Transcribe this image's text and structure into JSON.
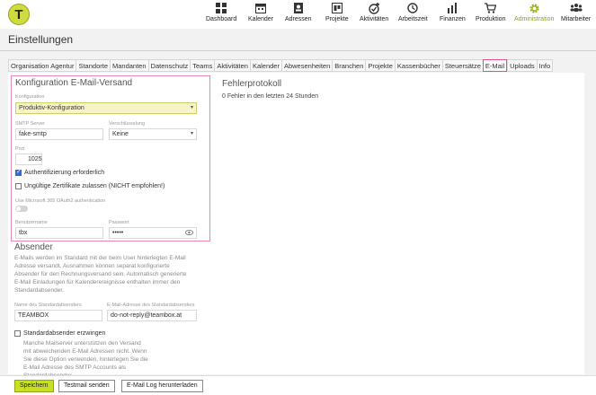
{
  "app": {
    "logo_letter": "T"
  },
  "nav": [
    {
      "label": "Dashboard",
      "icon": "grid-icon"
    },
    {
      "label": "Kalender",
      "icon": "calendar-icon"
    },
    {
      "label": "Adressen",
      "icon": "address-book-icon"
    },
    {
      "label": "Projekte",
      "icon": "folder-icon"
    },
    {
      "label": "Aktivitäten",
      "icon": "activity-icon"
    },
    {
      "label": "Arbeitszeit",
      "icon": "clock-icon"
    },
    {
      "label": "Finanzen",
      "icon": "finance-chart-icon"
    },
    {
      "label": "Produktion",
      "icon": "cart-icon"
    },
    {
      "label": "Administration",
      "icon": "gear-icon"
    },
    {
      "label": "Mitarbeiter",
      "icon": "users-icon"
    }
  ],
  "page_title": "Einstellungen",
  "tabs": [
    "Organisation Agentur",
    "Standorte",
    "Mandanten",
    "Datenschutz",
    "Teams",
    "Aktivitäten",
    "Kalender",
    "Abwesenheiten",
    "Branchen",
    "Projekte",
    "Kassenbücher",
    "Steuersätze",
    "E-Mail",
    "Uploads",
    "Info"
  ],
  "active_tab": "E-Mail",
  "config": {
    "heading": "Konfiguration E-Mail-Versand",
    "konfiguration_label": "Konfiguration",
    "konfiguration_value": "Produktiv-Konfiguration",
    "smtp_label": "SMTP Server",
    "smtp_value": "fake-smtp",
    "encryption_label": "Verschlüsselung",
    "encryption_value": "Keine",
    "port_label": "Port",
    "port_value": "1025",
    "auth_label": "Authentifizierung erforderlich",
    "auth_checked": true,
    "invalid_certs_label": "Ungültige Zertifikate zulassen (NICHT empfohlen!)",
    "invalid_certs_checked": false,
    "oauth_label": "Use Microsoft 365 OAuth2 authentication",
    "oauth_on": false,
    "username_label": "Benutzername",
    "username_value": "tbx",
    "password_label": "Passwort",
    "password_value": "•••••"
  },
  "sender": {
    "heading": "Absender",
    "description": "E-Mails werden im Standard mit der beim User hinterlegten E-Mail Adresse versandt. Ausnahmen hinterlegten E-Mail Adresse versandt. Ausnahmen können separat konfigurierte Absender für den Rechnungsversand sein. Automatisch generierte E-Mail Einladungen für Kalenderereignisse enthalten immer den Standardabsender.",
    "desc_lines": [
      "E-Mails werden im Standard mit der beim User hinterlegten E-Mail",
      "Adresse versandt. Ausnahmen können separat konfigurierte",
      "Absender für den Rechnungsversand sein. Automatisch generierte",
      "E-Mail Einladungen für Kalenderereignisse enthalten immer den",
      "Standardabsender."
    ],
    "name_label": "Name des Standardabsenders",
    "name_value": "TEAMBOX",
    "email_label": "E-Mail-Adresse des Standardabsenders",
    "email_value": "do-not-reply@teambox.at",
    "force_label": "Standardabsender erzwingen",
    "force_checked": false,
    "force_lines": [
      "Manche Mailserver unterstützen den Versand",
      "mit abweichenden E-Mail Adressen nicht. Wenn",
      "Sie diese Option verwenden, hinterlegen Sie die",
      "E-Mail Adresse des SMTP Accounts als",
      "Standardabsender."
    ]
  },
  "errorlog": {
    "heading": "Fehlerprotokoll",
    "text": "0 Fehler in den letzten 24 Stunden"
  },
  "footer": {
    "save": "Speichern",
    "test": "Testmail senden",
    "log": "E-Mail Log herunterladen"
  },
  "colors": {
    "accent": "#c9e020",
    "highlight": "#e44d8f",
    "active_nav": "#8ca21a"
  }
}
